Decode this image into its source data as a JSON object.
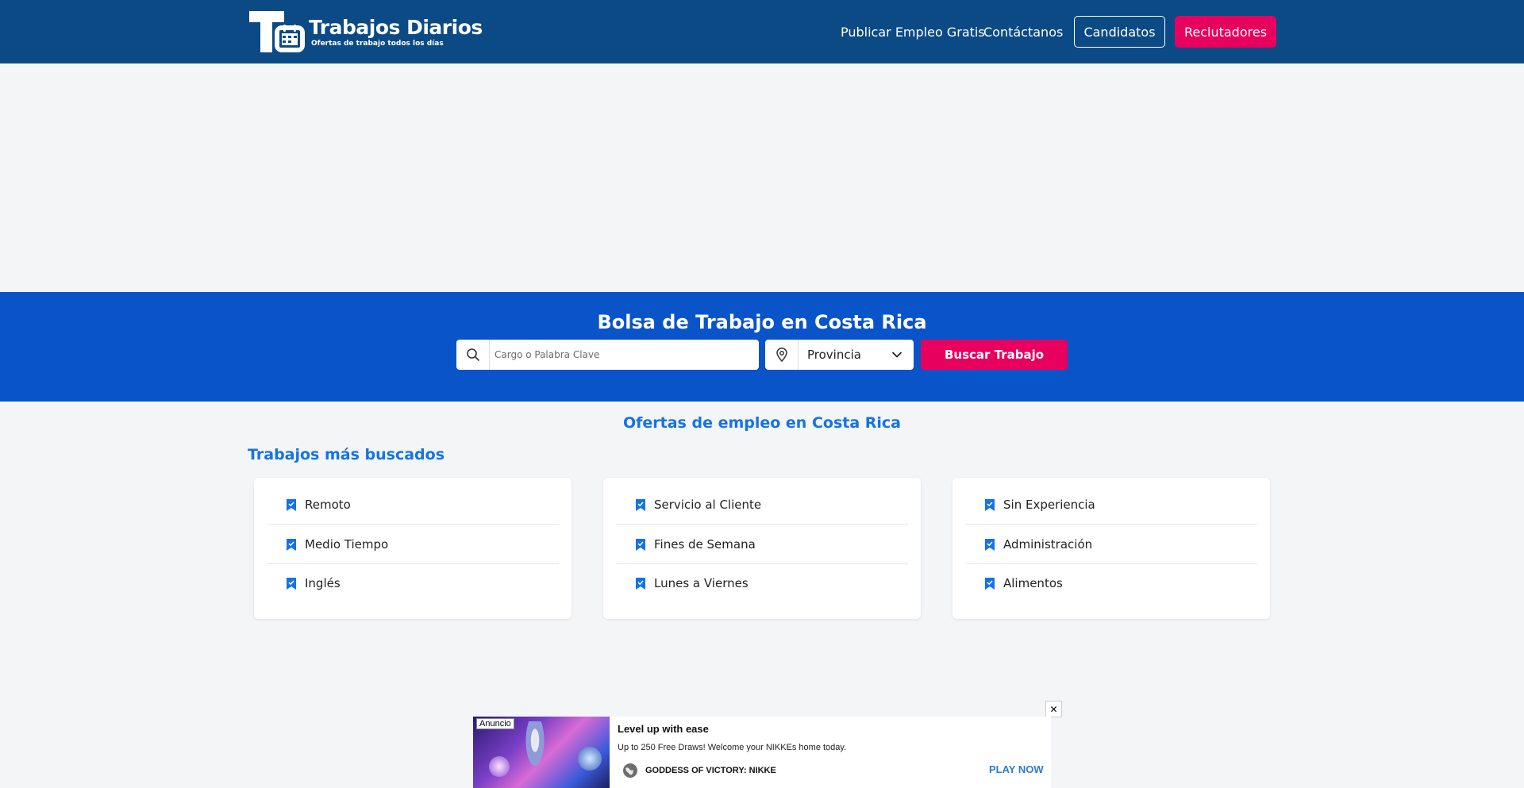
{
  "header": {
    "brand": "Trabajos Diarios",
    "tagline": "Ofertas de trabajo todos los días",
    "nav": [
      {
        "label": "Publicar Empleo Gratis"
      },
      {
        "label": "Contáctanos"
      }
    ],
    "candidatos_label": "Candidatos",
    "reclutadores_label": "Reclutadores"
  },
  "hero": {
    "title": "Bolsa de Trabajo en Costa Rica",
    "search_placeholder": "Cargo o Palabra Clave",
    "province_selected": "Provincia",
    "search_button": "Buscar Trabajo"
  },
  "main": {
    "section_title": "Ofertas de empleo en Costa Rica",
    "subtitle": "Trabajos más buscados",
    "cards": [
      {
        "items": [
          "Remoto",
          "Medio Tiempo",
          "Inglés"
        ]
      },
      {
        "items": [
          "Servicio al Cliente",
          "Fines de Semana",
          "Lunes a Viernes"
        ]
      },
      {
        "items": [
          "Sin Experiencia",
          "Administración",
          "Alimentos"
        ]
      }
    ]
  },
  "ad": {
    "tag": "Anuncio",
    "headline": "Level up with ease",
    "body": "Up to 250 Free Draws! Welcome your NIKKEs home today.",
    "advertiser": "GODDESS OF VICTORY: NIKKE",
    "cta": "PLAY NOW",
    "close_symbol": "✕"
  },
  "colors": {
    "header_bg": "#0b4a84",
    "hero_bg": "#0a54c9",
    "accent_pink": "#e8005f",
    "link_blue": "#1473e6"
  }
}
